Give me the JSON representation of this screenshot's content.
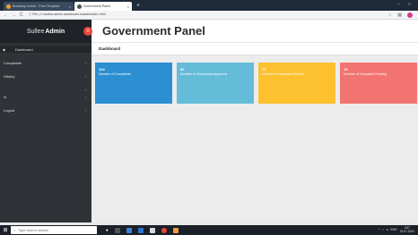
{
  "browser": {
    "tabs": [
      {
        "label": "Bootstrap Admin - Free Template",
        "close": "×"
      },
      {
        "label": "Government Panel",
        "close": "×"
      }
    ],
    "new_tab": "+",
    "window_controls": {
      "minimize": "–",
      "maximize": "□"
    },
    "nav": {
      "back": "←",
      "forward": "→",
      "reload": "C"
    },
    "url": "ⓘ File | C:/sullee-admin-dashboard-master/index.html"
  },
  "brand": {
    "first": "Sullee",
    "second": "Admin"
  },
  "toggle_icon": "≡",
  "page_title": "Government Panel",
  "sidebar": {
    "items": [
      {
        "label": "Dashboard",
        "icon": "dashboard-icon",
        "glyph": "◆",
        "chevron": ""
      },
      {
        "label": "Complaints",
        "icon": "",
        "glyph": "",
        "chevron": "›"
      },
      {
        "label": "History",
        "icon": "",
        "glyph": "",
        "chevron": "›"
      },
      {
        "label": "",
        "icon": "",
        "glyph": "",
        "chevron": "›"
      },
      {
        "label": "m",
        "icon": "",
        "glyph": "",
        "chevron": "›"
      },
      {
        "label": "Logout",
        "icon": "",
        "glyph": "",
        "chevron": "›"
      }
    ]
  },
  "breadcrumb": "Dashboard",
  "cards": [
    {
      "value": "104",
      "caption": "Number of Complaints",
      "color": "#2c8fd1"
    },
    {
      "value": "80",
      "caption": "Number of Complaints Approved",
      "color": "#64bcd8"
    },
    {
      "value": "70",
      "caption": "Number of Complaint Solved",
      "color": "#fdc02f"
    },
    {
      "value": "15",
      "caption": "Number of Complaint Pending",
      "color": "#f27470"
    }
  ],
  "taskbar": {
    "start_glyph": "⊞",
    "search_placeholder": "Type here to search",
    "search_glyph": "○",
    "tray_text": "ENG",
    "time": "2:07",
    "date": "21-07-2021"
  },
  "colors": {
    "sidebar": "#2f3337",
    "brand": "#1f2226",
    "toggle": "#e8453c",
    "taskbar": "#1b1f27"
  }
}
